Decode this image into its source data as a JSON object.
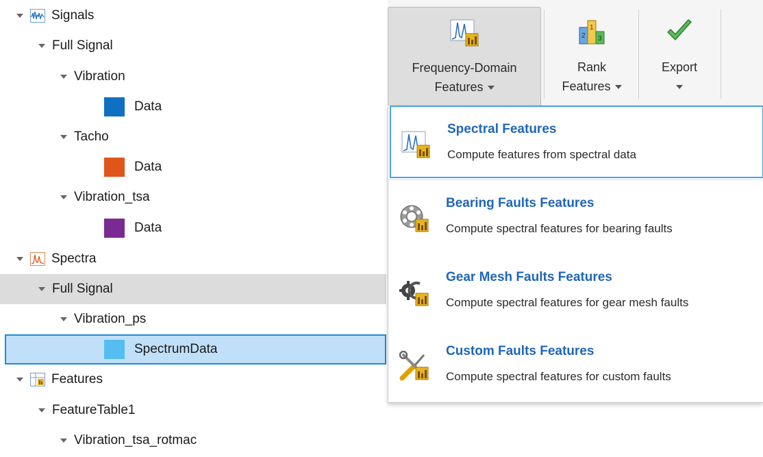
{
  "tree": {
    "rows": [
      {
        "label": "Signals",
        "indent": 1,
        "icon": "signals-icon"
      },
      {
        "label": "Full Signal",
        "indent": 2
      },
      {
        "label": "Vibration",
        "indent": 3
      },
      {
        "label": "Data",
        "indent": 4,
        "swatch": "#0f6fc2"
      },
      {
        "label": "Tacho",
        "indent": 3
      },
      {
        "label": "Data",
        "indent": 4,
        "swatch": "#e0561a"
      },
      {
        "label": "Vibration_tsa",
        "indent": 3
      },
      {
        "label": "Data",
        "indent": 4,
        "swatch": "#7b2a93"
      },
      {
        "label": "Spectra",
        "indent": 1,
        "icon": "spectra-icon"
      },
      {
        "label": "Full Signal",
        "indent": 2,
        "state": "highlighted"
      },
      {
        "label": "Vibration_ps",
        "indent": 3
      },
      {
        "label": "SpectrumData",
        "indent": 4,
        "swatch": "#55bdf0",
        "state": "selected"
      },
      {
        "label": "Features",
        "indent": 1,
        "icon": "features-icon"
      },
      {
        "label": "FeatureTable1",
        "indent": 2
      },
      {
        "label": "Vibration_tsa_rotmac",
        "indent": 3
      }
    ]
  },
  "toolstrip": {
    "frequency_domain": {
      "line1": "Frequency-Domain",
      "line2": "Features",
      "icon": "frequency-domain-icon"
    },
    "rank": {
      "line1": "Rank",
      "line2": "Features",
      "icon": "rank-features-icon"
    },
    "export": {
      "line1": "Export",
      "icon": "checkmark-icon"
    }
  },
  "menu": {
    "items": [
      {
        "title": "Spectral Features",
        "desc": "Compute features from spectral data",
        "icon": "spectral-features-icon",
        "active": true
      },
      {
        "title": "Bearing Faults Features",
        "desc": "Compute spectral features for bearing faults",
        "icon": "bearing-icon"
      },
      {
        "title": "Gear Mesh Faults Features",
        "desc": "Compute spectral features for gear mesh faults",
        "icon": "gear-icon"
      },
      {
        "title": "Custom Faults Features",
        "desc": "Compute spectral features for custom faults",
        "icon": "tools-icon"
      }
    ]
  },
  "colors": {
    "accent_title": "#1f66b8",
    "selection_fill": "#bfe0f8",
    "selection_border": "#1f8ad6",
    "highlight_fill": "#dcdcdc"
  }
}
